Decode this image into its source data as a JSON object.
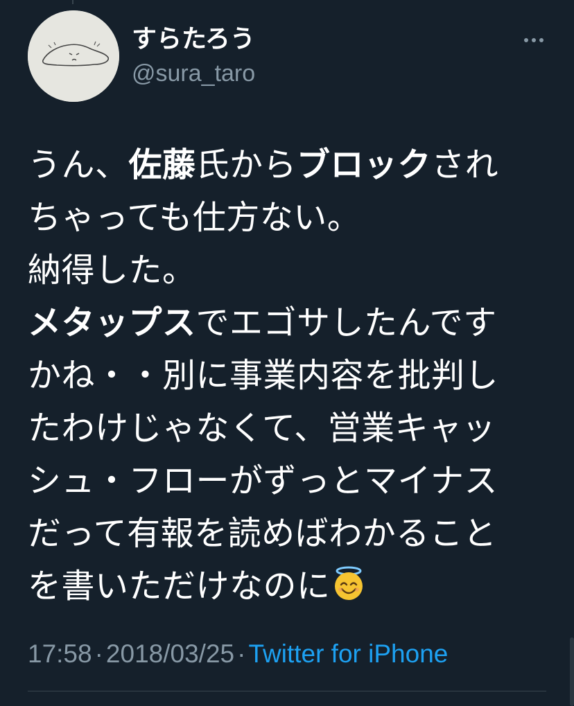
{
  "user": {
    "display_name": "すらたろう",
    "handle": "@sura_taro"
  },
  "tweet": {
    "segments": [
      {
        "text": "うん、",
        "bold": false
      },
      {
        "text": "佐藤",
        "bold": true
      },
      {
        "text": "氏から",
        "bold": false
      },
      {
        "text": "ブロック",
        "bold": true
      },
      {
        "text": "され",
        "bold": false
      },
      {
        "br": true
      },
      {
        "text": "ちゃっても仕方ない。",
        "bold": false
      },
      {
        "br": true
      },
      {
        "text": "納得した。",
        "bold": false
      },
      {
        "br": true
      },
      {
        "text": "メタップス",
        "bold": true
      },
      {
        "text": "でエゴサしたんです",
        "bold": false
      },
      {
        "br": true
      },
      {
        "text": "かね・・別に事業内容を批判し",
        "bold": false
      },
      {
        "br": true
      },
      {
        "text": "たわけじゃなくて、営業キャッ",
        "bold": false
      },
      {
        "br": true
      },
      {
        "text": "シュ・フローがずっとマイナス",
        "bold": false
      },
      {
        "br": true
      },
      {
        "text": "だって有報を読めばわかること",
        "bold": false
      },
      {
        "br": true
      },
      {
        "text": "を書いただけなのに",
        "bold": false
      },
      {
        "emoji": "smiling-face-with-halo"
      }
    ],
    "time": "17:58",
    "separator": "·",
    "date": "2018/03/25",
    "source": "Twitter for iPhone"
  },
  "icons": {
    "more": "more-horizontal-icon",
    "emoji": "smiling-face-with-halo-icon"
  },
  "colors": {
    "background": "#15202b",
    "text": "#ffffff",
    "secondary": "#8899a6",
    "accent": "#1da1f2",
    "divider": "#38444d"
  }
}
